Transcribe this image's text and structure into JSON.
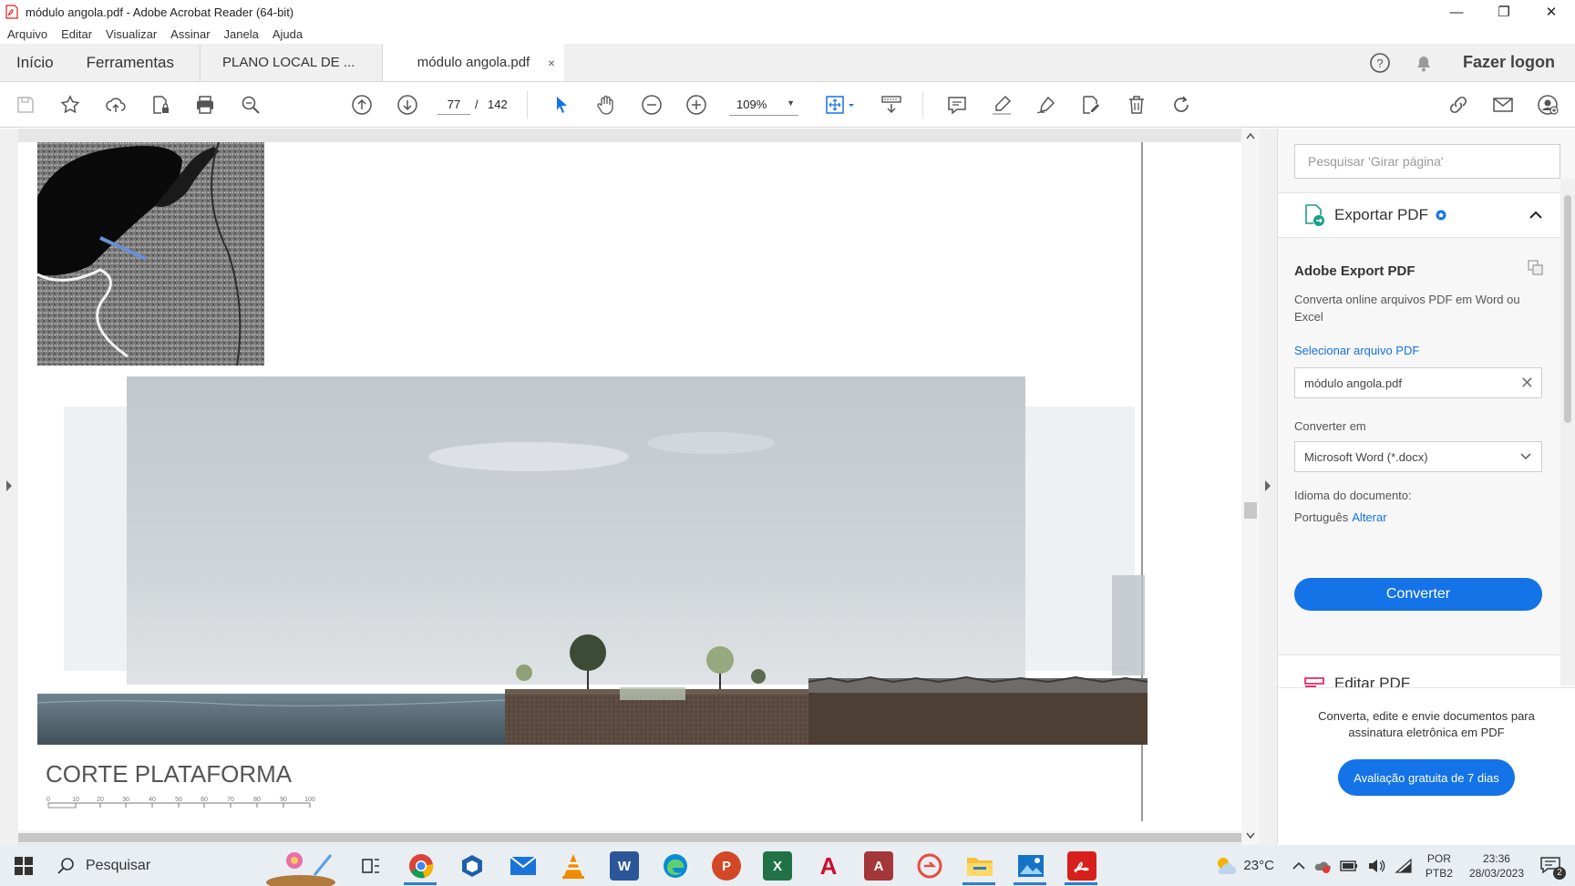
{
  "window": {
    "title": "módulo angola.pdf - Adobe Acrobat Reader (64-bit)",
    "minimize": "—",
    "restore": "❐",
    "close": "✕"
  },
  "menu": [
    "Arquivo",
    "Editar",
    "Visualizar",
    "Assinar",
    "Janela",
    "Ajuda"
  ],
  "tabs": {
    "home": "Início",
    "tools": "Ferramentas",
    "doc1": "PLANO LOCAL DE ...",
    "doc2": "módulo angola.pdf",
    "close": "×",
    "login": "Fazer logon"
  },
  "toolbar": {
    "current_page": "77",
    "separator": "/",
    "total_pages": "142",
    "zoom": "109%"
  },
  "document": {
    "section_title": "CORTE PLATAFORMA",
    "scale_ticks": [
      "0",
      "10",
      "20",
      "30",
      "40",
      "50",
      "60",
      "70",
      "80",
      "90",
      "100"
    ]
  },
  "pane": {
    "search_placeholder": "Pesquisar 'Girar página'",
    "export_title": "Exportar PDF",
    "heading": "Adobe Export PDF",
    "description": "Converta online arquivos PDF em Word ou Excel",
    "select_file_link": "Selecionar arquivo PDF",
    "selected_file": "módulo angola.pdf",
    "convert_to_label": "Converter em",
    "convert_to_value": "Microsoft Word (*.docx)",
    "language_label": "Idioma do documento:",
    "language_value": "Português",
    "language_change": "Alterar",
    "convert_button": "Converter",
    "edit_title": "Editar PDF",
    "promo_text": "Converta, edite e envie documentos para assinatura eletrônica em PDF",
    "trial_button": "Avaliação gratuita de 7 dias"
  },
  "taskbar": {
    "search_label": "Pesquisar",
    "temperature": "23°C",
    "lang_line1": "POR",
    "lang_line2": "PTB2",
    "time": "23:36",
    "date": "28/03/2023",
    "notif_count": "2"
  },
  "colors": {
    "accent": "#1473e6",
    "acrobat_red": "#d7201c"
  }
}
